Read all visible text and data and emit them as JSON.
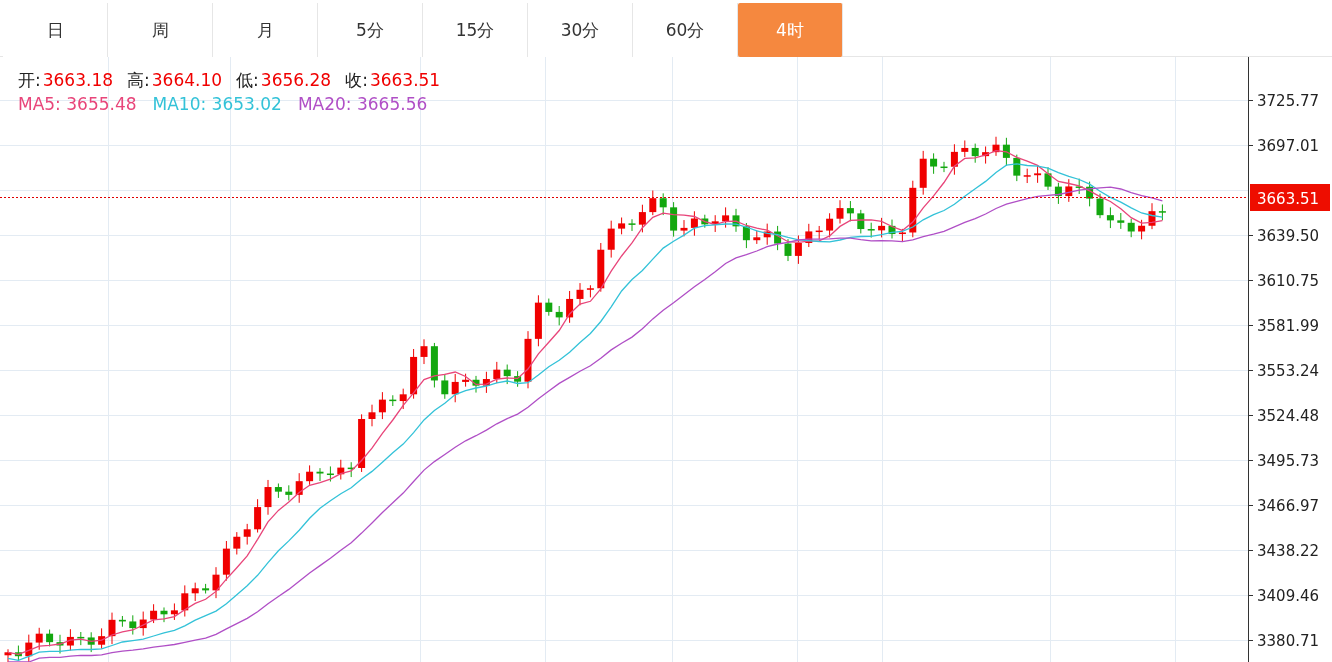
{
  "tabs": [
    {
      "label": "日",
      "selected": false
    },
    {
      "label": "周",
      "selected": false
    },
    {
      "label": "月",
      "selected": false
    },
    {
      "label": "5分",
      "selected": false
    },
    {
      "label": "15分",
      "selected": false
    },
    {
      "label": "30分",
      "selected": false
    },
    {
      "label": "60分",
      "selected": false
    },
    {
      "label": "4时",
      "selected": true
    }
  ],
  "ohlc": [
    {
      "label": "开:",
      "value": "3663.18"
    },
    {
      "label": "高:",
      "value": "3664.10"
    },
    {
      "label": "低:",
      "value": "3656.28"
    },
    {
      "label": "收:",
      "value": "3663.51"
    }
  ],
  "moving_averages": [
    {
      "label": "MA5:",
      "value": "3655.48",
      "color": "#e8457a"
    },
    {
      "label": "MA10:",
      "value": "3653.02",
      "color": "#33c2d8"
    },
    {
      "label": "MA20:",
      "value": "3665.56",
      "color": "#b04fc6"
    }
  ],
  "y_axis": [
    "3725.77",
    "3697.01",
    "3639.50",
    "3610.75",
    "3581.99",
    "3553.24",
    "3524.48",
    "3495.73",
    "3466.97",
    "3438.22",
    "3409.46",
    "3380.71"
  ],
  "last_price": "3663.51"
}
